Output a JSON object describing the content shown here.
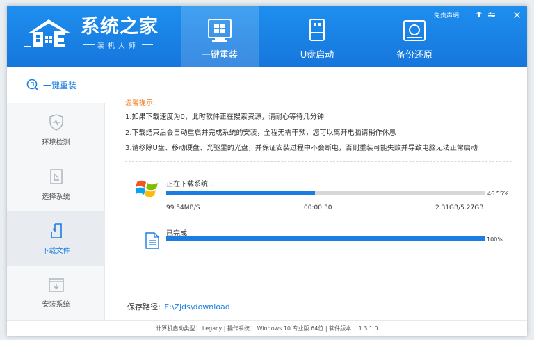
{
  "app": {
    "title": "系统之家",
    "subtitle": "装机大师"
  },
  "nav": {
    "items": [
      {
        "label": "一键重装",
        "icon": "reinstall-icon",
        "active": true
      },
      {
        "label": "U盘启动",
        "icon": "usb-icon",
        "active": false
      },
      {
        "label": "备份还原",
        "icon": "backup-icon",
        "active": false
      }
    ]
  },
  "topbar": {
    "disclaimer": "免责声明",
    "controls": [
      "skin-icon",
      "settings-icon",
      "minimize-icon",
      "close-icon"
    ]
  },
  "sidebar": {
    "header": "一键重装",
    "items": [
      {
        "label": "环境检测",
        "icon": "shield-icon",
        "current": false
      },
      {
        "label": "选择系统",
        "icon": "select-system-icon",
        "current": false
      },
      {
        "label": "下载文件",
        "icon": "download-file-icon",
        "current": true
      },
      {
        "label": "安装系统",
        "icon": "install-system-icon",
        "current": false
      }
    ]
  },
  "tips": {
    "title": "温馨提示:",
    "lines": [
      "1.如果下载速度为0，此时软件正在搜索资源，请耐心等待几分钟",
      "2.下载结束后会自动重启并完成系统的安装，全程无需干预，您可以离开电脑请稍作休息",
      "3.请移除U盘、移动硬盘、光驱里的光盘，并保证安装过程中不会断电，否则重装可能失败并导致电脑无法正常启动"
    ]
  },
  "tasks": [
    {
      "label": "正在下载系统...",
      "progress": 0.4655,
      "percent_text": "46.55%",
      "speed": "99.54MB/S",
      "elapsed": "00:00:30",
      "size": "2.31GB/5.27GB"
    },
    {
      "label": "已完成",
      "progress": 1.0,
      "percent_text": "100%"
    }
  ],
  "save_path": {
    "label": "保存路径:",
    "value": "E:\\Zjds\\download"
  },
  "footer": {
    "text": "计算机启动类型： Legacy | 操作系统： Windows 10 专业版 64位 | 软件版本： 1.3.1.0"
  },
  "colors": {
    "accent": "#1b7de2",
    "header": "#1676dc",
    "tip_title": "#f07a1a",
    "track": "#d6d8da"
  }
}
